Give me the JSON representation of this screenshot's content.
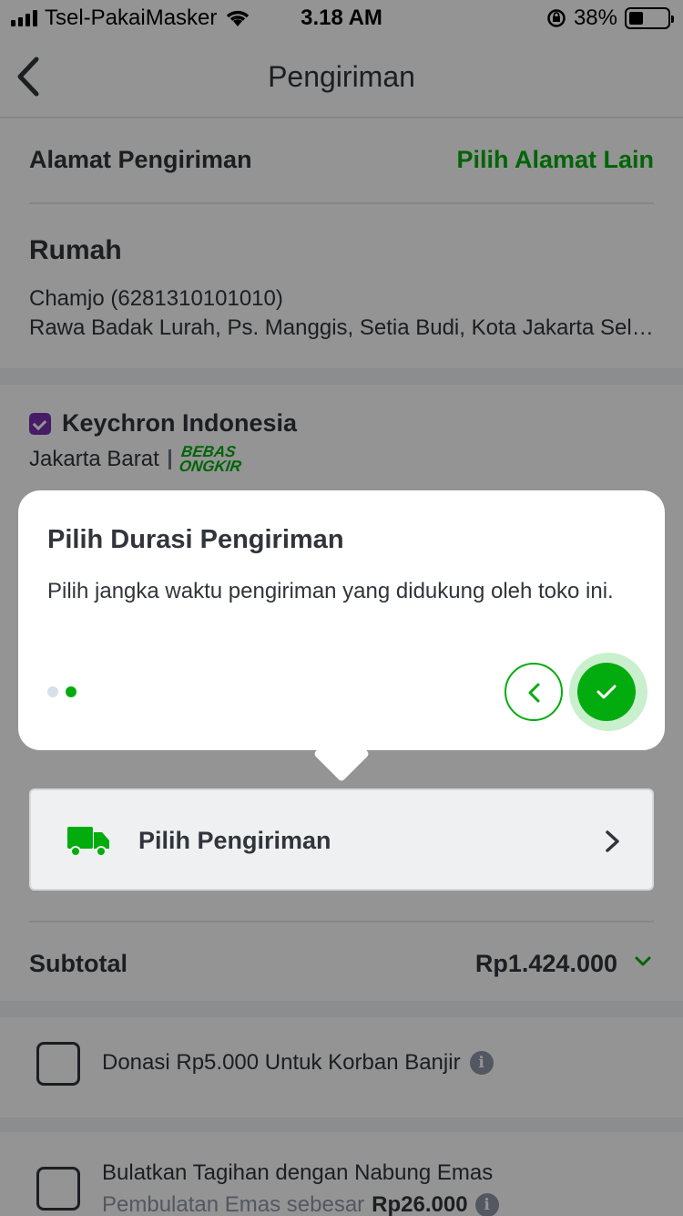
{
  "status_bar": {
    "carrier": "Tsel-PakaiMasker",
    "time": "3.18 AM",
    "battery_percent": "38%",
    "battery_level": 0.38
  },
  "nav": {
    "title": "Pengiriman",
    "back_icon": "chevron-left-icon"
  },
  "address": {
    "section_label": "Alamat Pengiriman",
    "change_link": "Pilih Alamat Lain",
    "label": "Rumah",
    "recipient": "Chamjo (6281310101010)",
    "line": "Rawa Badak Lurah, Ps. Manggis, Setia Budi, Kota Jakarta Selatan"
  },
  "shop": {
    "name": "Keychron Indonesia",
    "location": "Jakarta Barat",
    "badge_line1": "BEBAS",
    "badge_line2": "ONGKIR"
  },
  "shipping": {
    "button_label": "Pilih Pengiriman",
    "icon": "truck-icon"
  },
  "subtotal": {
    "label": "Subtotal",
    "value": "Rp1.424.000"
  },
  "options": [
    {
      "label": "Donasi Rp5.000 Untuk Korban Banjir"
    },
    {
      "label": "Bulatkan Tagihan dengan Nabung Emas",
      "sub_prefix": "Pembulatan Emas sebesar",
      "sub_amount": "Rp26.000"
    }
  ],
  "coachmark": {
    "title": "Pilih Durasi Pengiriman",
    "description": "Pilih jangka waktu pengiriman yang didukung oleh toko ini.",
    "step_current": 2,
    "step_total": 2
  },
  "colors": {
    "accent": "#03ac0e",
    "text": "#31353b",
    "muted": "#8d96aa",
    "dot_inactive": "#d6dfeb"
  }
}
